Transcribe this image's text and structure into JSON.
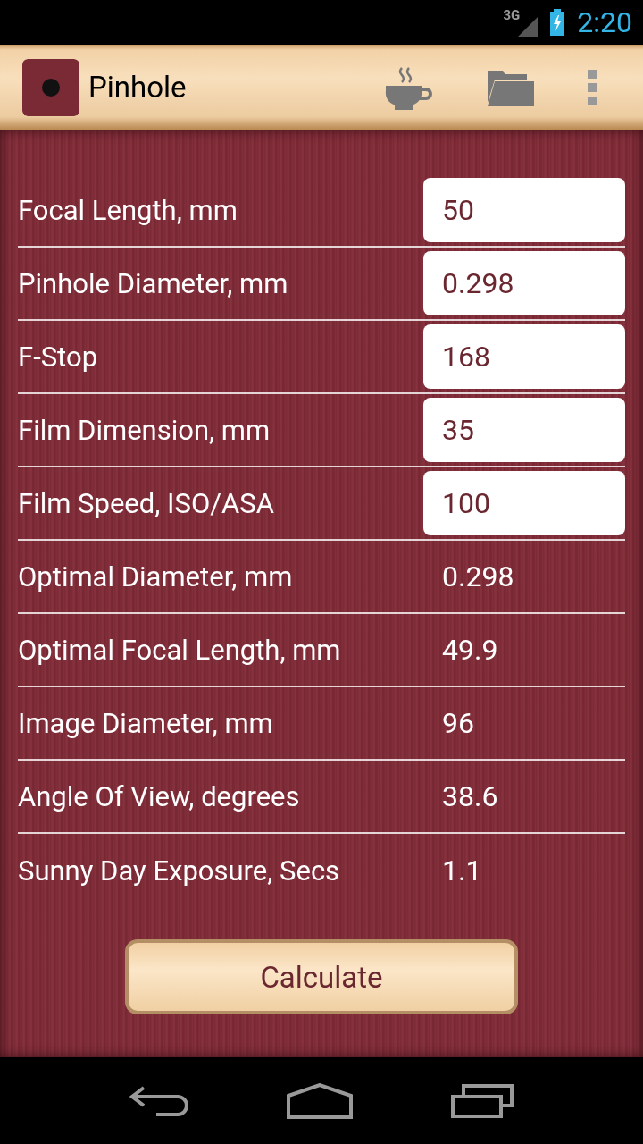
{
  "status_bar": {
    "network": "3G",
    "time": "2:20"
  },
  "app_bar": {
    "title": "Pinhole"
  },
  "fields": [
    {
      "label": "Focal Length, mm",
      "value": "50",
      "kind": "input"
    },
    {
      "label": "Pinhole Diameter, mm",
      "value": "0.298",
      "kind": "input"
    },
    {
      "label": "F-Stop",
      "value": "168",
      "kind": "input"
    },
    {
      "label": "Film Dimension, mm",
      "value": "35",
      "kind": "input"
    },
    {
      "label": "Film Speed, ISO/ASA",
      "value": "100",
      "kind": "input"
    },
    {
      "label": "Optimal Diameter, mm",
      "value": "0.298",
      "kind": "output"
    },
    {
      "label": "Optimal Focal Length, mm",
      "value": "49.9",
      "kind": "output"
    },
    {
      "label": "Image Diameter, mm",
      "value": "96",
      "kind": "output"
    },
    {
      "label": "Angle Of View, degrees",
      "value": "38.6",
      "kind": "output"
    },
    {
      "label": "Sunny Day Exposure, Secs",
      "value": "1.1",
      "kind": "output"
    }
  ],
  "calculate_button": "Calculate"
}
